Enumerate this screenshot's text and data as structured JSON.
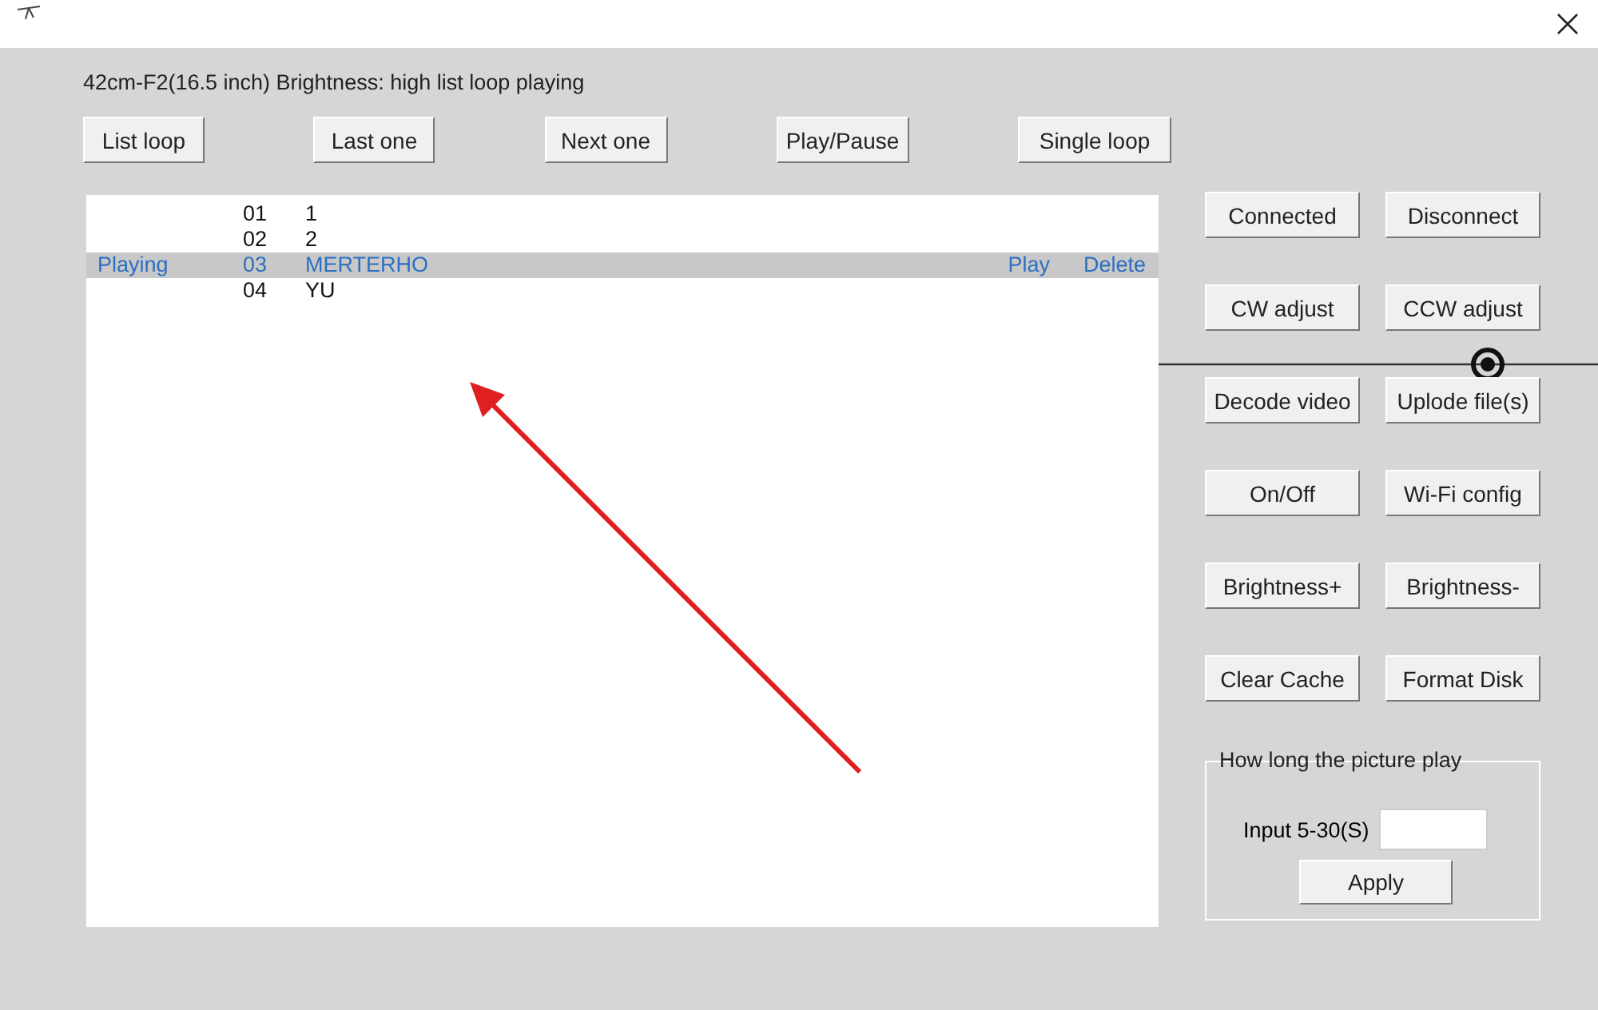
{
  "status_text": "42cm-F2(16.5 inch) Brightness: high list loop playing",
  "top_buttons": [
    "List loop",
    "Last one",
    "Next one",
    "Play/Pause",
    "Single loop"
  ],
  "playlist": [
    {
      "number": "01",
      "name": "1",
      "selected": false
    },
    {
      "number": "02",
      "name": "2",
      "selected": false
    },
    {
      "status": "Playing",
      "number": "03",
      "name": "MERTERHO",
      "selected": true,
      "actions": [
        "Play",
        "Delete"
      ]
    },
    {
      "number": "04",
      "name": "YU",
      "selected": false
    }
  ],
  "side_buttons": [
    [
      "Connected",
      "Disconnect"
    ],
    [
      "CW adjust",
      "CCW adjust"
    ],
    [
      "Decode video",
      "Uplode file(s)"
    ],
    [
      "On/Off",
      "Wi-Fi config"
    ],
    [
      "Brightness+",
      "Brightness-"
    ],
    [
      "Clear Cache",
      "Format Disk"
    ]
  ],
  "duration_group": {
    "title": "How long the picture play",
    "input_label": "Input 5-30(S)",
    "button": "Apply"
  }
}
